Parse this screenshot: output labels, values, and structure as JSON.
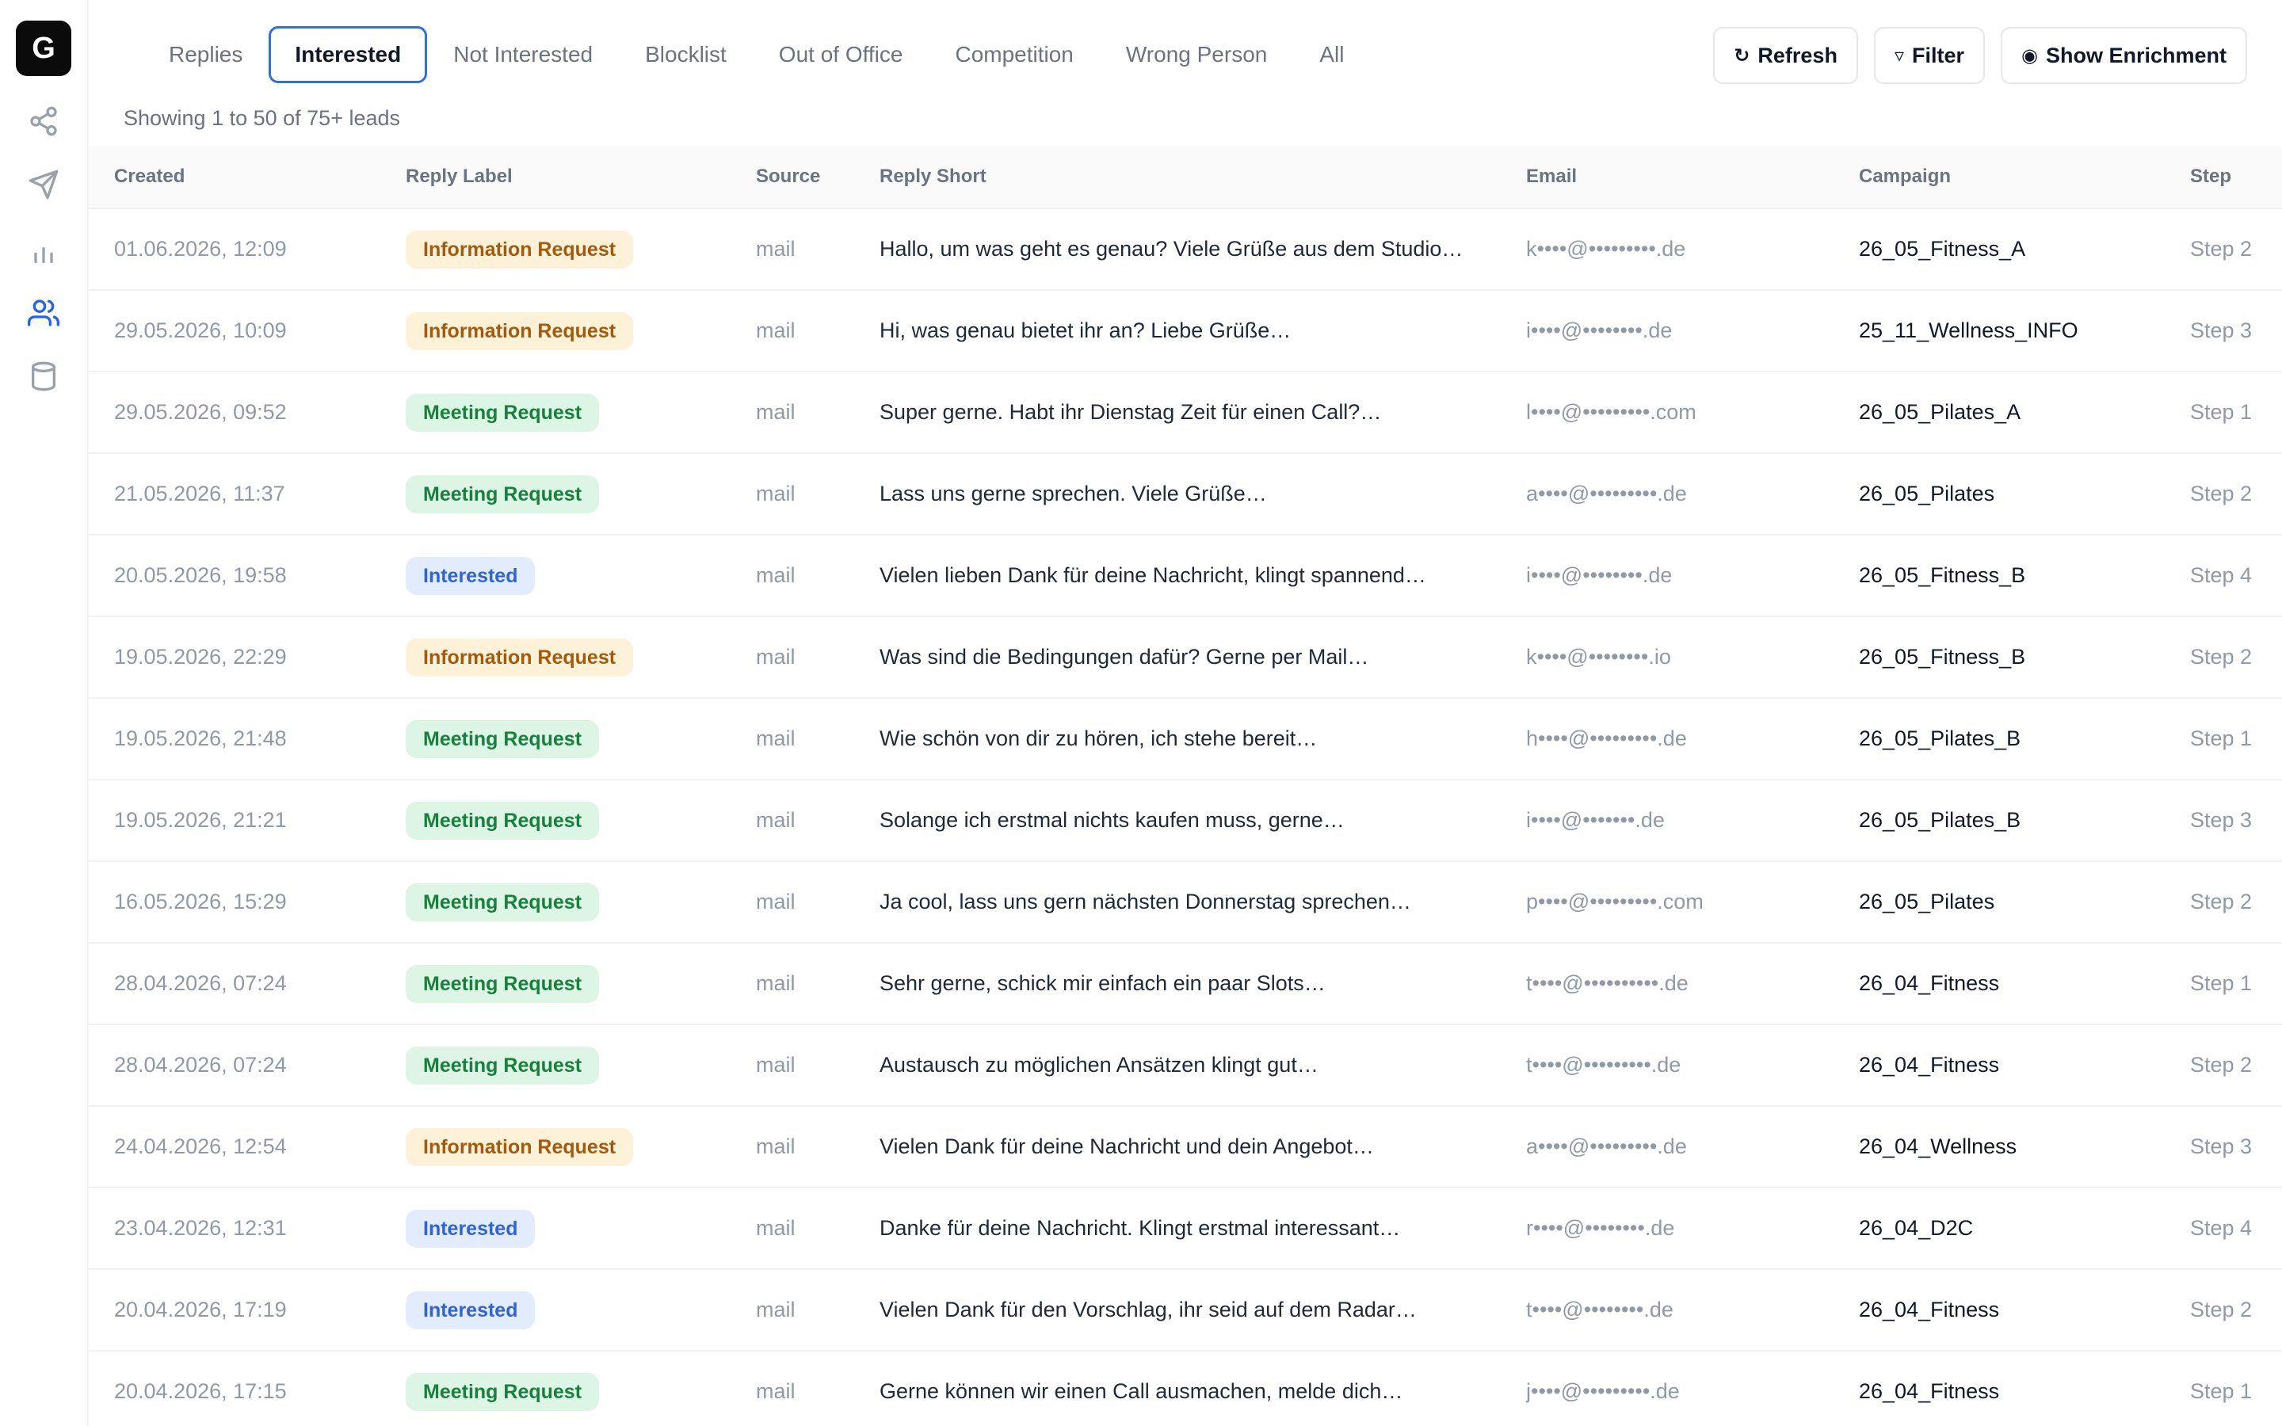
{
  "sidebar": {
    "logo": "G",
    "icons": [
      "share-icon",
      "send-icon",
      "bar-chart-icon",
      "users-icon",
      "database-icon"
    ]
  },
  "tabs": [
    {
      "label": "Replies",
      "active": false
    },
    {
      "label": "Interested",
      "active": true
    },
    {
      "label": "Not Interested",
      "active": false
    },
    {
      "label": "Blocklist",
      "active": false
    },
    {
      "label": "Out of Office",
      "active": false
    },
    {
      "label": "Competition",
      "active": false
    },
    {
      "label": "Wrong Person",
      "active": false
    },
    {
      "label": "All",
      "active": false
    }
  ],
  "toolbar": {
    "refresh_label": "Refresh",
    "filter_label": "Filter",
    "enrichment_label": "Show Enrichment"
  },
  "summary": "Showing 1 to 50 of 75+ leads",
  "table": {
    "columns": [
      "Created",
      "Reply Label",
      "Source",
      "Reply Short",
      "Email",
      "Campaign",
      "Step"
    ],
    "rows": [
      {
        "created": "01.06.2026, 12:09",
        "label": "Information Request",
        "type": "info",
        "source": "mail",
        "reply": "Hallo, um was geht es genau? Viele Grüße aus dem Studio…",
        "email": "k••••@•••••••••.de",
        "campaign": "26_05_Fitness_A",
        "step": "Step 2"
      },
      {
        "created": "29.05.2026, 10:09",
        "label": "Information Request",
        "type": "info",
        "source": "mail",
        "reply": "Hi, was genau bietet ihr an? Liebe Grüße…",
        "email": "i••••@••••••••.de",
        "campaign": "25_11_Wellness_INFO",
        "step": "Step 3"
      },
      {
        "created": "29.05.2026, 09:52",
        "label": "Meeting Request",
        "type": "meet",
        "source": "mail",
        "reply": "Super gerne. Habt ihr Dienstag Zeit für einen Call?…",
        "email": "l••••@•••••••••.com",
        "campaign": "26_05_Pilates_A",
        "step": "Step 1"
      },
      {
        "created": "21.05.2026, 11:37",
        "label": "Meeting Request",
        "type": "meet",
        "source": "mail",
        "reply": "Lass uns gerne sprechen. Viele Grüße…",
        "email": "a••••@•••••••••.de",
        "campaign": "26_05_Pilates",
        "step": "Step 2"
      },
      {
        "created": "20.05.2026, 19:58",
        "label": "Interested",
        "type": "int",
        "source": "mail",
        "reply": "Vielen lieben Dank für deine Nachricht, klingt spannend…",
        "email": "i••••@••••••••.de",
        "campaign": "26_05_Fitness_B",
        "step": "Step 4"
      },
      {
        "created": "19.05.2026, 22:29",
        "label": "Information Request",
        "type": "info",
        "source": "mail",
        "reply": "Was sind die Bedingungen dafür? Gerne per Mail…",
        "email": "k••••@••••••••.io",
        "campaign": "26_05_Fitness_B",
        "step": "Step 2"
      },
      {
        "created": "19.05.2026, 21:48",
        "label": "Meeting Request",
        "type": "meet",
        "source": "mail",
        "reply": "Wie schön von dir zu hören, ich stehe bereit…",
        "email": "h••••@•••••••••.de",
        "campaign": "26_05_Pilates_B",
        "step": "Step 1"
      },
      {
        "created": "19.05.2026, 21:21",
        "label": "Meeting Request",
        "type": "meet",
        "source": "mail",
        "reply": "Solange ich erstmal nichts kaufen muss, gerne…",
        "email": "i••••@•••••••.de",
        "campaign": "26_05_Pilates_B",
        "step": "Step 3"
      },
      {
        "created": "16.05.2026, 15:29",
        "label": "Meeting Request",
        "type": "meet",
        "source": "mail",
        "reply": "Ja cool, lass uns gern nächsten Donnerstag sprechen…",
        "email": "p••••@•••••••••.com",
        "campaign": "26_05_Pilates",
        "step": "Step 2"
      },
      {
        "created": "28.04.2026, 07:24",
        "label": "Meeting Request",
        "type": "meet",
        "source": "mail",
        "reply": "Sehr gerne, schick mir einfach ein paar Slots…",
        "email": "t••••@••••••••••.de",
        "campaign": "26_04_Fitness",
        "step": "Step 1"
      },
      {
        "created": "28.04.2026, 07:24",
        "label": "Meeting Request",
        "type": "meet",
        "source": "mail",
        "reply": "Austausch zu möglichen Ansätzen klingt gut…",
        "email": "t••••@•••••••••.de",
        "campaign": "26_04_Fitness",
        "step": "Step 2"
      },
      {
        "created": "24.04.2026, 12:54",
        "label": "Information Request",
        "type": "info",
        "source": "mail",
        "reply": "Vielen Dank für deine Nachricht und dein Angebot…",
        "email": "a••••@•••••••••.de",
        "campaign": "26_04_Wellness",
        "step": "Step 3"
      },
      {
        "created": "23.04.2026, 12:31",
        "label": "Interested",
        "type": "int",
        "source": "mail",
        "reply": "Danke für deine Nachricht. Klingt erstmal interessant…",
        "email": "r••••@••••••••.de",
        "campaign": "26_04_D2C",
        "step": "Step 4"
      },
      {
        "created": "20.04.2026, 17:19",
        "label": "Interested",
        "type": "int",
        "source": "mail",
        "reply": "Vielen Dank für den Vorschlag, ihr seid auf dem Radar…",
        "email": "t••••@••••••••.de",
        "campaign": "26_04_Fitness",
        "step": "Step 2"
      },
      {
        "created": "20.04.2026, 17:15",
        "label": "Meeting Request",
        "type": "meet",
        "source": "mail",
        "reply": "Gerne können wir einen Call ausmachen, melde dich…",
        "email": "j••••@•••••••••.de",
        "campaign": "26_04_Fitness",
        "step": "Step 1"
      }
    ]
  },
  "colors": {
    "accent": "#2f6fe4",
    "info_bg": "#fdf1d7",
    "info_fg": "#a45a0d",
    "meeting_bg": "#dcf5e4",
    "meeting_fg": "#17803d",
    "interested_bg": "#e2ecfd",
    "interested_fg": "#2f63d8"
  }
}
